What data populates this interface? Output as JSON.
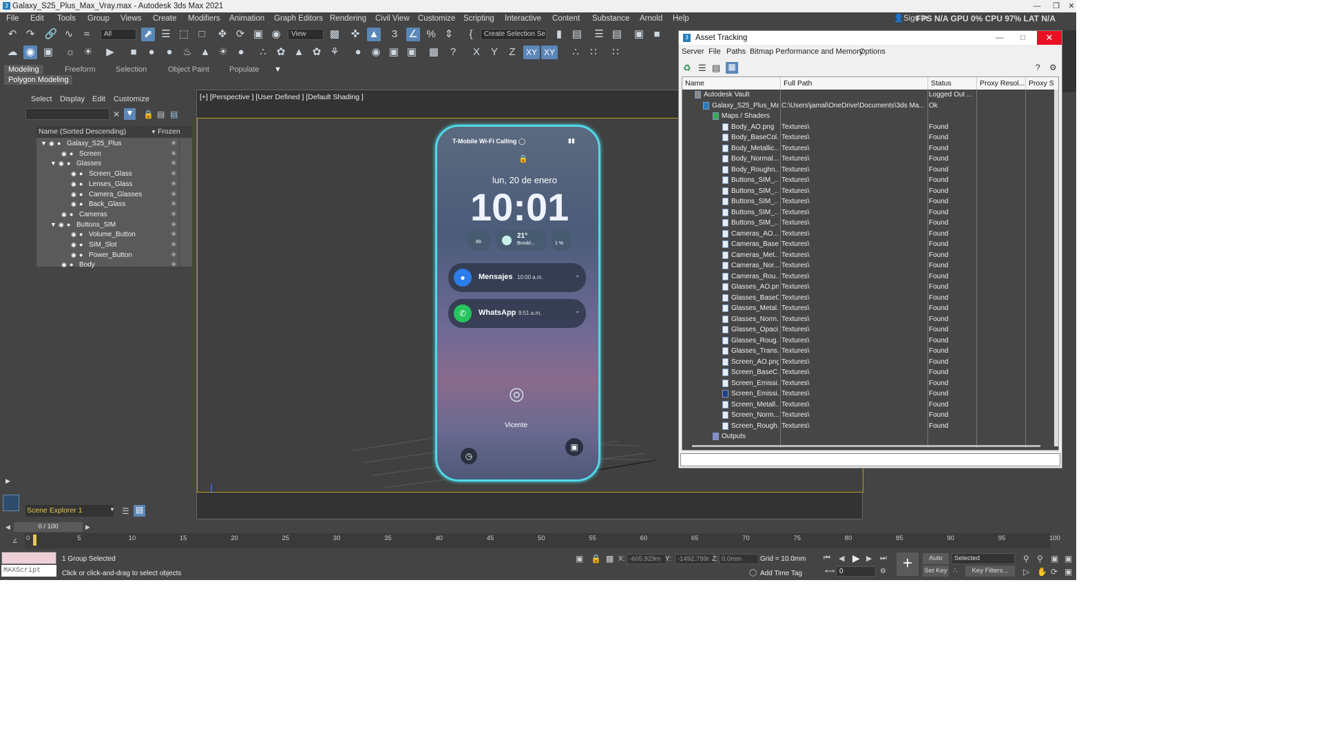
{
  "window": {
    "title": "Galaxy_S25_Plus_Max_Vray.max - Autodesk 3ds Max 2021",
    "status_text": "FPS N/A GPU 0% CPU 97% LAT N/A",
    "sign_in": "Sign in"
  },
  "menubar": [
    "File",
    "Edit",
    "Tools",
    "Group",
    "Views",
    "Create",
    "Modifiers",
    "Animation",
    "Graph Editors",
    "Rendering",
    "Civil View",
    "Customize",
    "Scripting",
    "Interactive",
    "Content",
    "Substance",
    "Arnold",
    "Help"
  ],
  "toolbar": {
    "filter_value": "All",
    "view_value": "View",
    "selection_set": "Create Selection Se",
    "axis_labels": [
      "X",
      "Y",
      "Z",
      "XY",
      "XY"
    ]
  },
  "ribbon": {
    "tabs": [
      "Modeling",
      "Freeform",
      "Selection",
      "Object Paint",
      "Populate"
    ],
    "sub": "Polygon Modeling"
  },
  "scene_explorer": {
    "menu": [
      "Select",
      "Display",
      "Edit",
      "Customize"
    ],
    "col_name": "Name (Sorted Descending)",
    "col_frozen": "Frozen",
    "items": [
      {
        "name": "Galaxy_S25_Plus",
        "level": 0
      },
      {
        "name": "Screen",
        "level": 1
      },
      {
        "name": "Glasses",
        "level": 1
      },
      {
        "name": "Screen_Glass",
        "level": 2
      },
      {
        "name": "Lenses_Glass",
        "level": 2
      },
      {
        "name": "Camera_Glasses",
        "level": 2
      },
      {
        "name": "Back_Glass",
        "level": 2
      },
      {
        "name": "Cameras",
        "level": 1
      },
      {
        "name": "Buttons_SIM",
        "level": 1
      },
      {
        "name": "Volume_Button",
        "level": 2
      },
      {
        "name": "SIM_Slot",
        "level": 2
      },
      {
        "name": "Power_Button",
        "level": 2
      },
      {
        "name": "Body",
        "level": 1
      }
    ],
    "explorer_name": "Scene Explorer 1"
  },
  "viewport": {
    "label": "[+] [Perspective ] [User Defined ] [Default Shading ]",
    "phone": {
      "carrier": "T-Mobile Wi-Fi Calling",
      "date": "lun, 20 de enero",
      "time": "10:01",
      "weather_temp": "21°",
      "weather_loc": "Brookl...",
      "battery_small": "1 %",
      "steps": "89",
      "notif1_title": "Mensajes",
      "notif1_time": "10:00 a.m.",
      "notif2_title": "WhatsApp",
      "notif2_time": "9:51 a.m.",
      "owner": "Vicente"
    }
  },
  "timeline": {
    "frame": "0 / 100",
    "ticks": [
      "0",
      "5",
      "10",
      "15",
      "20",
      "25",
      "30",
      "35",
      "40",
      "45",
      "50",
      "55",
      "60",
      "65",
      "70",
      "75",
      "80",
      "85",
      "90",
      "95",
      "100"
    ]
  },
  "statusbar": {
    "maxscript": "MAXScript Mi:",
    "selected": "1 Group Selected",
    "hint": "Click or click-and-drag to select objects",
    "x_label": "X:",
    "x_value": "-605.929m",
    "y_label": "Y:",
    "y_value": "-1492.799r",
    "z_label": "Z:",
    "z_value": "0.0mm",
    "grid": "Grid = 10.0mm",
    "add_time_tag": "Add Time Tag",
    "frame_field": "0",
    "auto_key": "Auto Key",
    "set_key": "Set Key",
    "selected_dd": "Selected",
    "key_filters": "Key Filters..."
  },
  "asset_tracking": {
    "title": "Asset Tracking",
    "menu": [
      "Server",
      "File",
      "Paths",
      "Bitmap Performance and Memory",
      "Options"
    ],
    "columns": [
      "Name",
      "Full Path",
      "Status",
      "Proxy Resol...",
      "Proxy S"
    ],
    "rows": [
      {
        "name": "Autodesk Vault",
        "path": "",
        "status": "Logged Out ...",
        "indent": 1,
        "icon": "vault"
      },
      {
        "name": "Galaxy_S25_Plus_Ma...",
        "path": "C:\\Users\\jamal\\OneDrive\\Documents\\3ds Ma...",
        "status": "Ok",
        "indent": 2,
        "icon": "max"
      },
      {
        "name": "Maps / Shaders",
        "path": "",
        "status": "",
        "indent": 3,
        "icon": "maps"
      },
      {
        "name": "Body_AO.png",
        "path": "Textures\\",
        "status": "Found",
        "indent": 4,
        "icon": "file"
      },
      {
        "name": "Body_BaseCol...",
        "path": "Textures\\",
        "status": "Found",
        "indent": 4,
        "icon": "file"
      },
      {
        "name": "Body_Metallic...",
        "path": "Textures\\",
        "status": "Found",
        "indent": 4,
        "icon": "file"
      },
      {
        "name": "Body_Normal...",
        "path": "Textures\\",
        "status": "Found",
        "indent": 4,
        "icon": "file"
      },
      {
        "name": "Body_Roughn...",
        "path": "Textures\\",
        "status": "Found",
        "indent": 4,
        "icon": "file"
      },
      {
        "name": "Buttons_SIM_...",
        "path": "Textures\\",
        "status": "Found",
        "indent": 4,
        "icon": "file"
      },
      {
        "name": "Buttons_SIM_...",
        "path": "Textures\\",
        "status": "Found",
        "indent": 4,
        "icon": "file"
      },
      {
        "name": "Buttons_SIM_...",
        "path": "Textures\\",
        "status": "Found",
        "indent": 4,
        "icon": "file"
      },
      {
        "name": "Buttons_SIM_...",
        "path": "Textures\\",
        "status": "Found",
        "indent": 4,
        "icon": "file"
      },
      {
        "name": "Buttons_SIM_...",
        "path": "Textures\\",
        "status": "Found",
        "indent": 4,
        "icon": "file"
      },
      {
        "name": "Cameras_AO....",
        "path": "Textures\\",
        "status": "Found",
        "indent": 4,
        "icon": "file"
      },
      {
        "name": "Cameras_Base...",
        "path": "Textures\\",
        "status": "Found",
        "indent": 4,
        "icon": "file"
      },
      {
        "name": "Cameras_Met...",
        "path": "Textures\\",
        "status": "Found",
        "indent": 4,
        "icon": "file"
      },
      {
        "name": "Cameras_Nor...",
        "path": "Textures\\",
        "status": "Found",
        "indent": 4,
        "icon": "file"
      },
      {
        "name": "Cameras_Rou...",
        "path": "Textures\\",
        "status": "Found",
        "indent": 4,
        "icon": "file"
      },
      {
        "name": "Glasses_AO.png",
        "path": "Textures\\",
        "status": "Found",
        "indent": 4,
        "icon": "file"
      },
      {
        "name": "Glasses_BaseC...",
        "path": "Textures\\",
        "status": "Found",
        "indent": 4,
        "icon": "file"
      },
      {
        "name": "Glasses_Metal...",
        "path": "Textures\\",
        "status": "Found",
        "indent": 4,
        "icon": "file"
      },
      {
        "name": "Glasses_Norm...",
        "path": "Textures\\",
        "status": "Found",
        "indent": 4,
        "icon": "file"
      },
      {
        "name": "Glasses_Opaci...",
        "path": "Textures\\",
        "status": "Found",
        "indent": 4,
        "icon": "file"
      },
      {
        "name": "Glasses_Roug...",
        "path": "Textures\\",
        "status": "Found",
        "indent": 4,
        "icon": "file"
      },
      {
        "name": "Glasses_Trans...",
        "path": "Textures\\",
        "status": "Found",
        "indent": 4,
        "icon": "file"
      },
      {
        "name": "Screen_AO.png",
        "path": "Textures\\",
        "status": "Found",
        "indent": 4,
        "icon": "file"
      },
      {
        "name": "Screen_BaseC...",
        "path": "Textures\\",
        "status": "Found",
        "indent": 4,
        "icon": "file"
      },
      {
        "name": "Screen_Emissi...",
        "path": "Textures\\",
        "status": "Found",
        "indent": 4,
        "icon": "file"
      },
      {
        "name": "Screen_Emissi...",
        "path": "Textures\\",
        "status": "Found",
        "indent": 4,
        "icon": "psd"
      },
      {
        "name": "Screen_Metall...",
        "path": "Textures\\",
        "status": "Found",
        "indent": 4,
        "icon": "file"
      },
      {
        "name": "Screen_Norm...",
        "path": "Textures\\",
        "status": "Found",
        "indent": 4,
        "icon": "file"
      },
      {
        "name": "Screen_Rough...",
        "path": "Textures\\",
        "status": "Found",
        "indent": 4,
        "icon": "file"
      },
      {
        "name": "Outputs",
        "path": "",
        "status": "",
        "indent": 3,
        "icon": "outputs"
      }
    ]
  },
  "colors": {
    "ui_bg": "#444444",
    "accent": "#5b87b8",
    "phone_outline": "#4fd9e8",
    "viewport_frame": "#b5a12a",
    "close_red": "#e81123"
  }
}
